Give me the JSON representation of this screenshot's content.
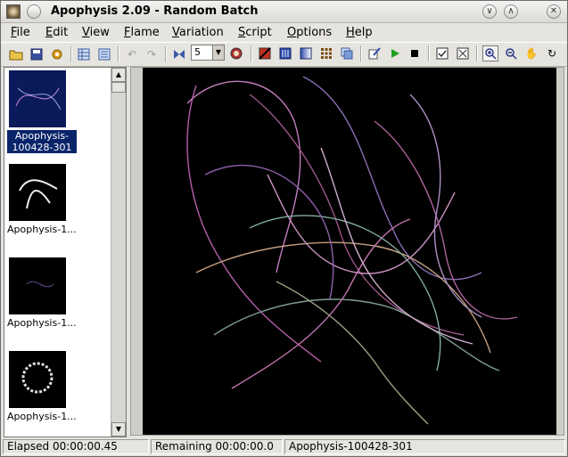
{
  "window": {
    "title": "Apophysis 2.09 - Random Batch"
  },
  "menu": [
    {
      "u": "F",
      "rest": "ile"
    },
    {
      "u": "E",
      "rest": "dit"
    },
    {
      "u": "V",
      "rest": "iew"
    },
    {
      "u": "F",
      "rest": "lame"
    },
    {
      "u": "V",
      "rest": "ariation"
    },
    {
      "u": "S",
      "rest": "cript"
    },
    {
      "u": "O",
      "rest": "ptions"
    },
    {
      "u": "H",
      "rest": "elp"
    }
  ],
  "toolbar": {
    "density_value": "5",
    "icons": [
      "open-icon",
      "save-icon",
      "settings-icon",
      "list-view-icon",
      "thumbnail-view-icon",
      "undo-icon",
      "redo-icon",
      "mutate-icon",
      "render-icon",
      "gradient-icon",
      "adjust-icon",
      "colormap-icon",
      "grid-icon",
      "transform-icon",
      "edit-script-icon",
      "play-icon",
      "stop-icon",
      "checkbox-icon",
      "fullscreen-icon",
      "zoom-in-icon",
      "zoom-out-icon",
      "pan-icon",
      "rotate-icon"
    ]
  },
  "thumbnails": [
    {
      "label": "Apophysis-100428-301",
      "selected": true
    },
    {
      "label": "Apophysis-1..."
    },
    {
      "label": "Apophysis-1..."
    },
    {
      "label": "Apophysis-1..."
    }
  ],
  "status": {
    "elapsed": "Elapsed 00:00:00.45",
    "remaining": "Remaining 00:00:00.0",
    "flame": "Apophysis-100428-301"
  },
  "colors": {
    "selection": "#0a246a",
    "preview_bg": "#000000"
  }
}
